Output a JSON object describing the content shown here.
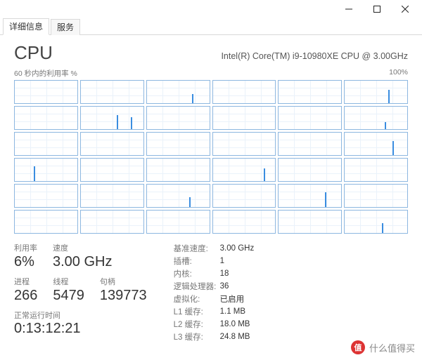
{
  "window": {
    "titlebar": {
      "min": "minimize",
      "max": "maximize",
      "close": "close"
    }
  },
  "tabs": {
    "details": "详细信息",
    "services": "服务"
  },
  "header": {
    "title": "CPU",
    "subtitle": "Intel(R) Core(TM) i9-10980XE CPU @ 3.00GHz"
  },
  "axis": {
    "left": "60 秒内的利用率 %",
    "right": "100%"
  },
  "chart_data": {
    "type": "area",
    "title": "Per-logical-processor utilization",
    "ylabel": "Utilization %",
    "ylim": [
      0,
      100
    ],
    "xlabel": "Seconds (last 60s)",
    "series_count": 36,
    "note": "36 sparkline panels in a 6×6 grid; most cores near idle with occasional short spikes on a few cores."
  },
  "metrics": {
    "util_label": "利用率",
    "util_value": "6%",
    "speed_label": "速度",
    "speed_value": "3.00 GHz",
    "proc_label": "进程",
    "proc_value": "266",
    "thread_label": "线程",
    "thread_value": "5479",
    "handle_label": "句柄",
    "handle_value": "139773",
    "uptime_label": "正常运行时间",
    "uptime_value": "0:13:12:21"
  },
  "specs": {
    "base_speed_k": "基准速度:",
    "base_speed_v": "3.00 GHz",
    "sockets_k": "插槽:",
    "sockets_v": "1",
    "cores_k": "内核:",
    "cores_v": "18",
    "lprocs_k": "逻辑处理器:",
    "lprocs_v": "36",
    "virt_k": "虚拟化:",
    "virt_v": "已启用",
    "l1_k": "L1 缓存:",
    "l1_v": "1.1 MB",
    "l2_k": "L2 缓存:",
    "l2_v": "18.0 MB",
    "l3_k": "L3 缓存:",
    "l3_v": "24.8 MB"
  },
  "watermark": {
    "logo": "值",
    "text": "什么值得买"
  }
}
